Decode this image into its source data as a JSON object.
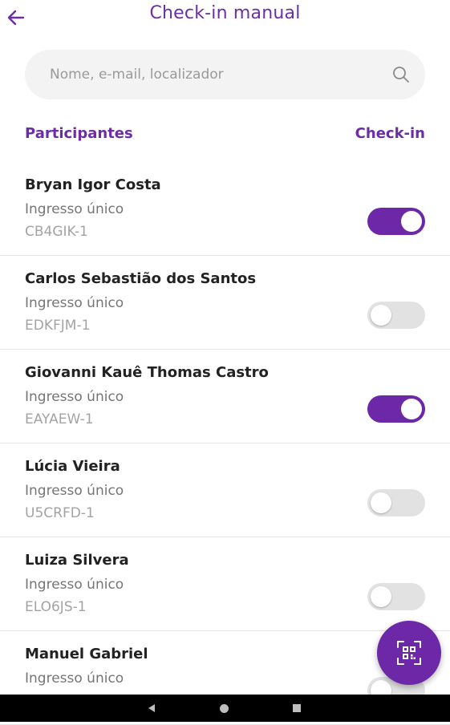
{
  "header": {
    "title": "Check-in manual",
    "back_icon": "arrow-left-icon"
  },
  "search": {
    "placeholder": "Nome, e-mail, localizador",
    "value": "",
    "icon": "search-icon"
  },
  "columns": {
    "left": "Participantes",
    "right": "Check-in"
  },
  "participants": [
    {
      "name": "Bryan Igor Costa",
      "ticket": "Ingresso único",
      "code": "CB4GIK-1",
      "checked_in": true
    },
    {
      "name": "Carlos Sebastião dos Santos",
      "ticket": "Ingresso único",
      "code": "EDKFJM-1",
      "checked_in": false
    },
    {
      "name": "Giovanni Kauê Thomas Castro",
      "ticket": "Ingresso único",
      "code": "EAYAEW-1",
      "checked_in": true
    },
    {
      "name": "Lúcia  Vieira",
      "ticket": "Ingresso único",
      "code": "U5CRFD-1",
      "checked_in": false
    },
    {
      "name": "Luiza  Silvera",
      "ticket": "Ingresso único",
      "code": "ELO6JS-1",
      "checked_in": false
    },
    {
      "name": "Manuel Gabriel",
      "ticket": "Ingresso único",
      "code": "",
      "checked_in": false
    }
  ],
  "fab": {
    "icon": "qr-scan-icon"
  },
  "colors": {
    "accent": "#6d28a8",
    "title": "#6b2ea6",
    "toggle_off": "#e2e2e2"
  },
  "system_nav": {
    "back": "nav-back-icon",
    "home": "nav-home-icon",
    "recents": "nav-recents-icon"
  }
}
